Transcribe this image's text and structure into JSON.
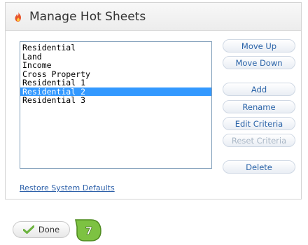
{
  "dialog": {
    "title": "Manage Hot Sheets",
    "list_items": [
      {
        "label": "Residential",
        "selected": false
      },
      {
        "label": "Land",
        "selected": false
      },
      {
        "label": "Income",
        "selected": false
      },
      {
        "label": "Cross Property",
        "selected": false
      },
      {
        "label": "Residential 1",
        "selected": false
      },
      {
        "label": "Residential 2",
        "selected": true
      },
      {
        "label": "Residential 3",
        "selected": false
      }
    ],
    "buttons": {
      "move_up": "Move Up",
      "move_down": "Move Down",
      "add": "Add",
      "rename": "Rename",
      "edit_criteria": "Edit Criteria",
      "reset_criteria": "Reset Criteria",
      "delete": "Delete"
    },
    "restore_link": "Restore System Defaults"
  },
  "footer": {
    "done_label": "Done",
    "step_number": "7"
  },
  "colors": {
    "selection": "#3399ff",
    "button_text": "#2a63a8",
    "badge_fill": "#7dc242"
  }
}
